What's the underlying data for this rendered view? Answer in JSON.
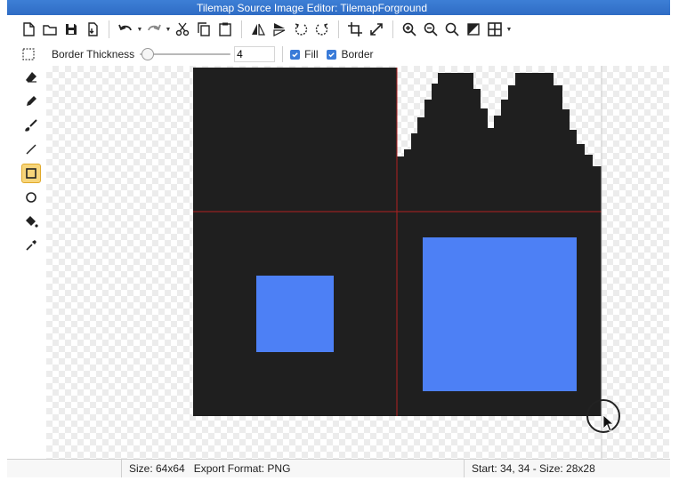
{
  "window": {
    "title": "Tilemap Source Image Editor: TilemapForground"
  },
  "toolbar": {
    "icons": [
      "new-file-icon",
      "open-folder-icon",
      "save-icon",
      "export-icon",
      "undo-icon",
      "redo-icon",
      "cut-icon",
      "copy-icon",
      "paste-icon",
      "flip-horizontal-icon",
      "flip-vertical-icon",
      "rotate-left-icon",
      "rotate-right-icon",
      "crop-icon",
      "resize-icon",
      "zoom-in-icon",
      "zoom-out-icon",
      "zoom-fit-icon",
      "invert-icon",
      "grid-icon"
    ]
  },
  "options": {
    "border_thickness_label": "Border Thickness",
    "border_thickness_value": "4",
    "fill_label": "Fill",
    "fill_checked": true,
    "border_label": "Border",
    "border_checked": true
  },
  "tools": [
    {
      "name": "eraser-icon",
      "active": false
    },
    {
      "name": "pencil-icon",
      "active": false
    },
    {
      "name": "brush-icon",
      "active": false
    },
    {
      "name": "line-icon",
      "active": false
    },
    {
      "name": "rectangle-icon",
      "active": true
    },
    {
      "name": "ellipse-icon",
      "active": false
    },
    {
      "name": "fill-bucket-icon",
      "active": false
    },
    {
      "name": "eyedropper-icon",
      "active": false
    }
  ],
  "colors": {
    "tile_fill": "#1f1f1f",
    "shape_fill": "#4d80f5",
    "guide_line": "#b02020",
    "accent": "#3a7bd8"
  },
  "status": {
    "size": "Size: 64x64",
    "export_format": "Export Format: PNG",
    "selection": "Start: 34, 34 - Size: 28x28"
  }
}
